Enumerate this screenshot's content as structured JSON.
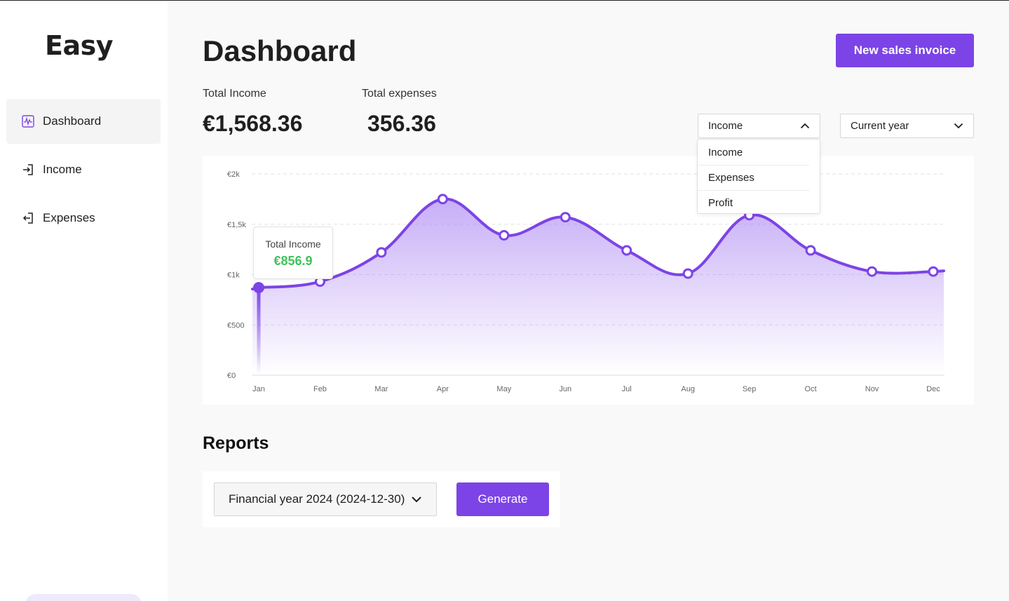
{
  "app": {
    "logo": "Easy"
  },
  "sidebar": {
    "items": [
      {
        "label": "Dashboard",
        "icon": "activity-chart-icon",
        "active": true
      },
      {
        "label": "Income",
        "icon": "sign-in-icon",
        "active": false
      },
      {
        "label": "Expenses",
        "icon": "sign-out-icon",
        "active": false
      }
    ]
  },
  "header": {
    "title": "Dashboard",
    "new_invoice_label": "New sales invoice"
  },
  "stats": {
    "total_income_label": "Total Income",
    "total_income_value": "€1,568.36",
    "total_expenses_label": "Total expenses",
    "total_expenses_value": "356.36"
  },
  "filters": {
    "metric_selected": "Income",
    "metric_options": [
      "Income",
      "Expenses",
      "Profit"
    ],
    "metric_open": true,
    "period_selected": "Current year"
  },
  "tooltip": {
    "label": "Total Income",
    "value": "€856.9"
  },
  "colors": {
    "accent": "#7c44e6",
    "tooltip_value": "#3fc35a"
  },
  "chart_data": {
    "type": "area",
    "categories": [
      "Jan",
      "Feb",
      "Mar",
      "Apr",
      "May",
      "Jun",
      "Jul",
      "Aug",
      "Sep",
      "Oct",
      "Nov",
      "Dec"
    ],
    "series": [
      {
        "values": [
          870,
          930,
          1220,
          1750,
          1390,
          1570,
          1240,
          1010,
          1590,
          1240,
          1030,
          1030
        ]
      }
    ],
    "y_ticks": [
      "€0",
      "€500",
      "€1k",
      "€1,5k",
      "€2k"
    ],
    "y_tick_values": [
      0,
      500,
      1000,
      1500,
      2000
    ],
    "ylim": [
      0,
      2000
    ],
    "highlighted_index": 0,
    "grid": true
  },
  "reports": {
    "title": "Reports",
    "selected_year": "Financial year 2024 (2024-12-30)",
    "generate_label": "Generate"
  }
}
